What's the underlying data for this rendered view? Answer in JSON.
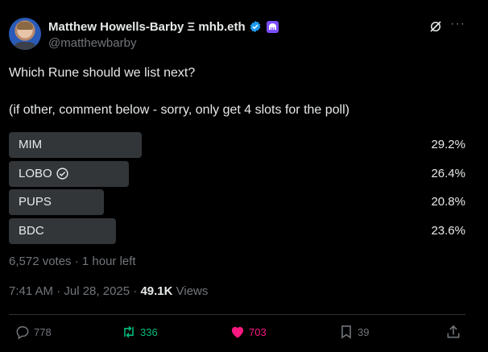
{
  "author": {
    "display_name": "Matthew Howells-Barby Ξ mhb.eth",
    "handle": "@matthewbarby"
  },
  "question": "Which Rune should we list next?",
  "note": "(if other, comment below - sorry, only get 4 slots for the poll)",
  "poll": {
    "options": [
      {
        "label": "MIM",
        "percent": "29.2%",
        "fraction": 0.292
      },
      {
        "label": "LOBO",
        "percent": "26.4%",
        "fraction": 0.264,
        "voted": true
      },
      {
        "label": "PUPS",
        "percent": "20.8%",
        "fraction": 0.208
      },
      {
        "label": "BDC",
        "percent": "23.6%",
        "fraction": 0.236
      }
    ],
    "summary": "6,572 votes · 1 hour left"
  },
  "timestamp": "7:41 AM · Jul 28, 2025 · ",
  "views": {
    "count": "49.1K",
    "label": " Views"
  },
  "actions": {
    "replies": "778",
    "reposts": "336",
    "likes": "703",
    "bookmarks": "39"
  },
  "colors": {
    "background": "#000000",
    "text": "#e7e9ea",
    "muted": "#71767b",
    "poll_bar": "#333639",
    "verified": "#1d9bf0",
    "repost": "#00ba7c",
    "like": "#f91880"
  },
  "icons": [
    "verified-badge-icon",
    "app-badge-icon",
    "grok-icon",
    "more-icon",
    "check-circle-icon",
    "reply-icon",
    "repost-icon",
    "like-heart-icon",
    "bookmark-icon",
    "share-icon"
  ]
}
